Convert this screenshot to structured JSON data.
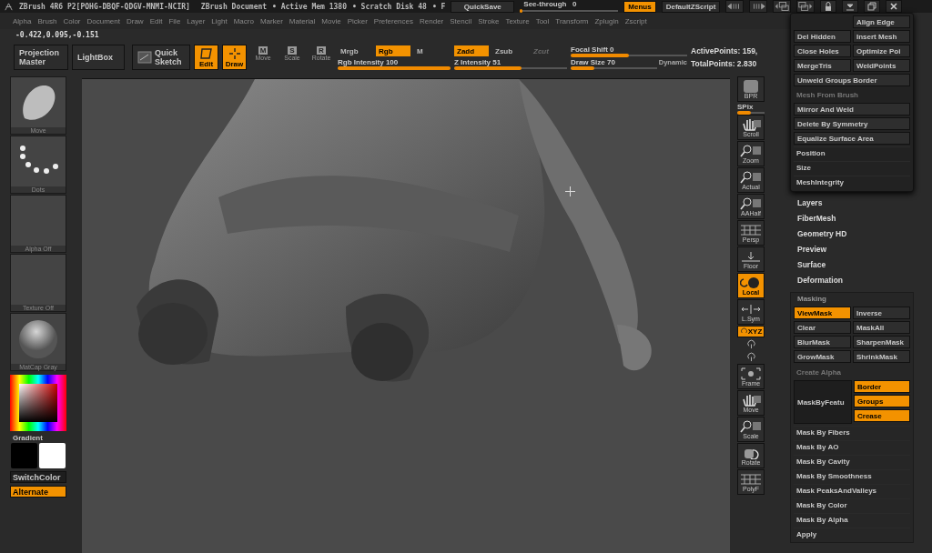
{
  "title_bar": {
    "app_title": "ZBrush 4R6 P2[POHG-DBQF-QDGV-MNMI-NCIR]",
    "document": "ZBrush Document",
    "active_mem": "• Active Mem 1380",
    "scratch_disk": "• Scratch Disk 48",
    "cut_item": "• F",
    "quicksave": "QuickSave",
    "see_through": {
      "label": "See-through",
      "value": "0",
      "level": 0
    },
    "menus": {
      "label": "Menus",
      "selected": true
    },
    "script": "DefaultZScript"
  },
  "menu_bar": [
    "Alpha",
    "Brush",
    "Color",
    "Document",
    "Draw",
    "Edit",
    "File",
    "Layer",
    "Light",
    "Macro",
    "Marker",
    "Material",
    "Movie",
    "Picker",
    "Preferences",
    "Render",
    "Stencil",
    "Stroke",
    "Texture",
    "Tool",
    "Transform",
    "Zplugin",
    "Zscript"
  ],
  "coordinates": "-0.422,0.095,-0.151",
  "toolbar": {
    "projection_master": "Projection Master",
    "lightbox": "LightBox",
    "quick_sketch": "Quick Sketch",
    "modes": [
      {
        "label": "Edit",
        "selected": true
      },
      {
        "label": "Draw",
        "selected": true
      }
    ],
    "transforms": [
      {
        "key": "M",
        "label": "Move",
        "selected": false
      },
      {
        "key": "S",
        "label": "Scale",
        "selected": false
      },
      {
        "key": "R",
        "label": "Rotate",
        "selected": false
      }
    ],
    "color_modes": [
      {
        "label": "Mrgb",
        "selected": false
      },
      {
        "label": "Rgb",
        "selected": true
      },
      {
        "label": "M",
        "selected": false
      }
    ],
    "rgb_intensity": {
      "label": "Rgb Intensity",
      "value": "100",
      "level": 1
    },
    "z_modes": [
      {
        "label": "Zadd",
        "selected": true,
        "disabled": false
      },
      {
        "label": "Zsub",
        "selected": false,
        "disabled": false
      },
      {
        "label": "Zcut",
        "selected": false,
        "disabled": true
      }
    ],
    "z_intensity": {
      "label": "Z Intensity",
      "value": "51",
      "level": 0.6
    },
    "focal_shift": {
      "label": "Focal Shift",
      "value": "0",
      "level": 0.5
    },
    "draw_size": {
      "label": "Draw Size",
      "value": "70",
      "level": 0.27
    },
    "dynamic": "Dynamic",
    "active_points": "ActivePoints: 159,",
    "total_points": "TotalPoints: 2.830"
  },
  "left_tray": {
    "tiles": [
      {
        "label": "Move",
        "kind": "brush"
      },
      {
        "label": "Dots",
        "kind": "stroke"
      },
      {
        "label": "Alpha Off",
        "kind": "blank"
      },
      {
        "label": "Texture Off",
        "kind": "blank"
      },
      {
        "label": "MatCap Gray",
        "kind": "sphere"
      }
    ],
    "gradient": "Gradient",
    "switch_color": "SwitchColor",
    "alternate": {
      "label": "Alternate",
      "selected": true
    }
  },
  "right_shelf": [
    {
      "label": "BPR",
      "kind": "bpr",
      "selected": false
    },
    {
      "label": "SPix",
      "kind": "slider",
      "level": 0.5
    },
    {
      "label": "Scroll",
      "kind": "hand",
      "selected": false
    },
    {
      "label": "Zoom",
      "kind": "magnifier",
      "selected": false
    },
    {
      "label": "Actual",
      "kind": "magnifier",
      "selected": false
    },
    {
      "label": "AAHalf",
      "kind": "magnifier",
      "selected": false
    },
    {
      "label": "Persp",
      "kind": "grid",
      "selected": false
    },
    {
      "label": "Floor",
      "kind": "floor",
      "selected": false
    },
    {
      "label": "Local",
      "kind": "local",
      "selected": true
    },
    {
      "label": "L.Sym",
      "kind": "sym",
      "selected": false
    },
    {
      "label": "XYZ",
      "kind": "xyz",
      "selected": true
    },
    {
      "kind": "rotate_small",
      "selected": false
    },
    {
      "kind": "rotate_small",
      "selected": false
    },
    {
      "label": "Frame",
      "kind": "frame",
      "selected": false
    },
    {
      "label": "Move",
      "kind": "hand",
      "selected": false
    },
    {
      "label": "Scale",
      "kind": "magnifier",
      "selected": false
    },
    {
      "label": "Rotate",
      "kind": "rotate",
      "selected": false
    },
    {
      "label": "PolyF",
      "kind": "grid",
      "selected": false
    }
  ],
  "geometry_popup": [
    {
      "kind": "half_right",
      "label": "Align Edge"
    },
    {
      "kind": "half",
      "label": "Del Hidden"
    },
    {
      "kind": "half",
      "label": "Insert Mesh"
    },
    {
      "kind": "half",
      "label": "Close Holes"
    },
    {
      "kind": "half",
      "label": "Optimize Poi"
    },
    {
      "kind": "half",
      "label": "MergeTris"
    },
    {
      "kind": "half",
      "label": "WeldPoints"
    },
    {
      "kind": "full",
      "label": "Unweld Groups Border"
    },
    {
      "kind": "disabled",
      "label": "Mesh From Brush"
    },
    {
      "kind": "full",
      "label": "Mirror And Weld"
    },
    {
      "kind": "full",
      "label": "Delete By Symmetry"
    },
    {
      "kind": "full",
      "label": "Equalize Surface Area"
    },
    {
      "kind": "sub",
      "label": "Position"
    },
    {
      "kind": "sub",
      "label": "Size"
    },
    {
      "kind": "sub",
      "label": "MeshIntegrity"
    }
  ],
  "palettes": [
    "Layers",
    "FiberMesh",
    "Geometry HD",
    "Preview",
    "Surface",
    "Deformation"
  ],
  "masking": {
    "title": "Masking",
    "buttons": [
      {
        "label": "ViewMask",
        "selected": true
      },
      {
        "label": "Inverse",
        "selected": false
      },
      {
        "label": "Clear",
        "selected": false
      },
      {
        "label": "MaskAll",
        "selected": false
      },
      {
        "label": "BlurMask",
        "selected": false
      },
      {
        "label": "SharpenMask",
        "selected": false
      },
      {
        "label": "GrowMask",
        "selected": false
      },
      {
        "label": "ShrinkMask",
        "selected": false
      }
    ],
    "create_alpha": "Create Alpha",
    "mask_by_features": {
      "label": "MaskByFeatu",
      "options": [
        {
          "label": "Border",
          "selected": true
        },
        {
          "label": "Groups",
          "selected": true
        },
        {
          "label": "Crease",
          "selected": true
        }
      ]
    },
    "items": [
      "Mask By Fibers",
      "Mask By AO",
      "Mask By Cavity",
      "Mask By Smoothness",
      "Mask PeaksAndValleys",
      "Mask By Color",
      "Mask By Alpha",
      "Apply"
    ]
  }
}
